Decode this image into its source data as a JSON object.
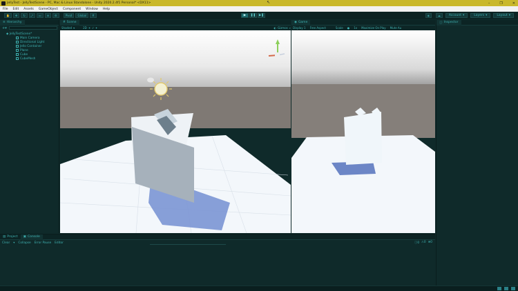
{
  "window": {
    "title": "JellyTest - JellyTestScene - PC, Mac & Linux Standalone - Unity 2020.2.4f1 Personal* <DX11>",
    "controls": [
      "–",
      "❐",
      "✕"
    ]
  },
  "menu": [
    "File",
    "Edit",
    "Assets",
    "GameObject",
    "Component",
    "Window",
    "Help"
  ],
  "toolbar": {
    "pivot_label": "Pivot",
    "global_label": "Global",
    "account_label": "Account",
    "layers_label": "Layers",
    "layout_label": "Layout"
  },
  "hierarchy": {
    "tab_label": "Hierarchy",
    "scene_name": "JellyTestScene*",
    "items": [
      "Main Camera",
      "Directional Light",
      "Jello Container",
      "Plane",
      "Cube",
      "CubeMesh"
    ]
  },
  "scene": {
    "tab_label": "Scene",
    "shading_mode": "Shaded",
    "gizmos_label": "Gizmos",
    "toggle_2d": "2D"
  },
  "game": {
    "tab_label": "Game",
    "display": "Display 1",
    "aspect": "Free Aspect",
    "scale_label": "Scale",
    "scale_value": "1x",
    "maximize": "Maximize On Play",
    "mute": "Mute Au"
  },
  "inspector": {
    "tab_label": "Inspector"
  },
  "console": {
    "project_tab": "Project",
    "console_tab": "Console",
    "clear": "Clear",
    "collapse": "Collapse",
    "error_pause": "Error Pause",
    "editor": "Editor",
    "count_log": "0",
    "count_warn": "0",
    "count_error": "0"
  },
  "colors": {
    "accent": "#3fb3b3",
    "panel": "#0f2a2a",
    "titlebar": "#c9b82b",
    "sky": "#8b8b8b",
    "ground": "#f4f8fb"
  }
}
